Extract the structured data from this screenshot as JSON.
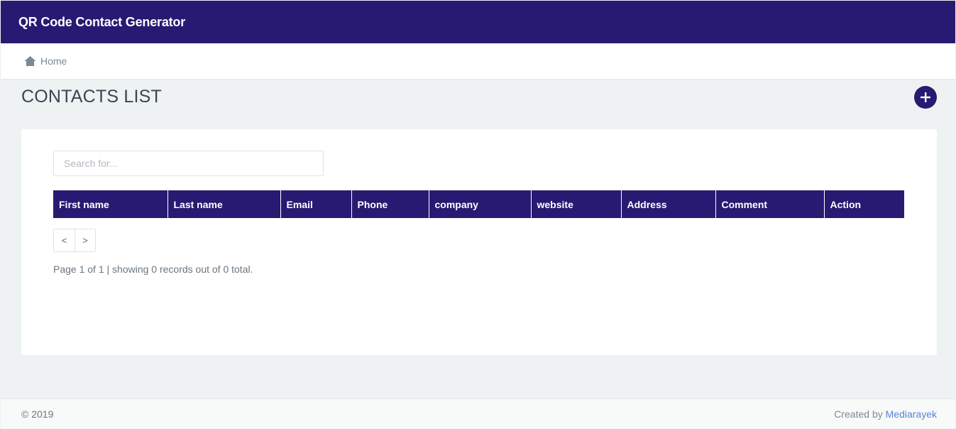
{
  "app": {
    "title": "QR Code Contact Generator"
  },
  "breadcrumb": {
    "home_label": "Home",
    "icon": "home-icon"
  },
  "page": {
    "title": "CONTACTS LIST",
    "add_icon": "plus-icon"
  },
  "search": {
    "placeholder": "Search for..."
  },
  "table": {
    "columns": [
      "First name",
      "Last name",
      "Email",
      "Phone",
      "company",
      "website",
      "Address",
      "Comment",
      "Action"
    ],
    "rows": []
  },
  "pagination": {
    "prev_label": "<",
    "next_label": ">",
    "info": "Page 1 of 1 | showing 0 records out of 0 total."
  },
  "footer": {
    "copyright": "© 2019",
    "created_by": "Created by",
    "author": "Mediarayek"
  },
  "colors": {
    "brand": "#281a72",
    "link": "#5d82d1",
    "background": "#eff2f3"
  }
}
